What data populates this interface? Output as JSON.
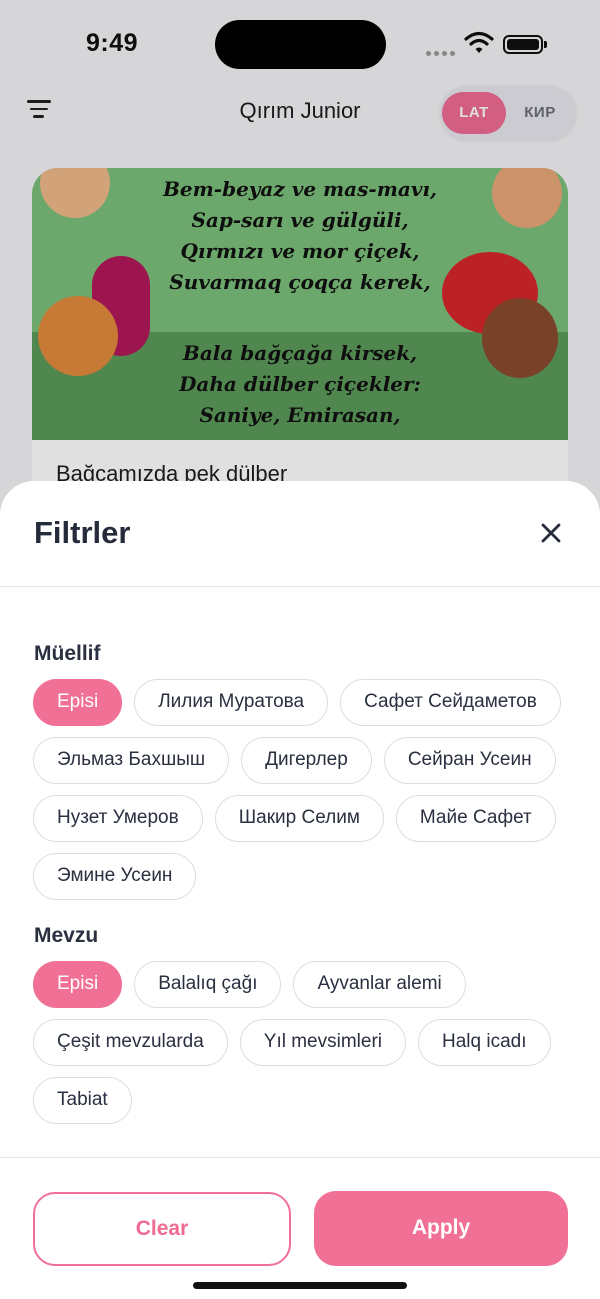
{
  "status": {
    "time": "9:49"
  },
  "app": {
    "title": "Qırım Junior",
    "lang": {
      "lat": "LAT",
      "kir": "КИР",
      "selected": "LAT"
    }
  },
  "card": {
    "poem_top": [
      "Bem-beyaz ve mas-mavı,",
      "Sap-sarı ve gülgüli,",
      "Qırmızı ve mor çiçek,",
      "Suvarmaq çoqça kerek,"
    ],
    "poem_bottom": [
      "Bala bağçağa kirsek,",
      "Daha dülber çiçekler:",
      "Saniye, Emirasan,"
    ],
    "title": "Bağçamızda pek dülber"
  },
  "filters": {
    "title": "Filtrler",
    "author": {
      "label": "Müellif",
      "options": [
        {
          "label": "Episi",
          "selected": true
        },
        {
          "label": "Лилия Муратова",
          "selected": false
        },
        {
          "label": "Сафет Сейдаметов",
          "selected": false
        },
        {
          "label": "Эльмаз Бахшыш",
          "selected": false
        },
        {
          "label": "Дигерлер",
          "selected": false
        },
        {
          "label": "Сейран Усеин",
          "selected": false
        },
        {
          "label": "Нузет Умеров",
          "selected": false
        },
        {
          "label": "Шакир Селим",
          "selected": false
        },
        {
          "label": "Майе Сафет",
          "selected": false
        },
        {
          "label": "Эмине Усеин",
          "selected": false
        }
      ]
    },
    "topic": {
      "label": "Mevzu",
      "options": [
        {
          "label": "Episi",
          "selected": true
        },
        {
          "label": "Balalıq çağı",
          "selected": false
        },
        {
          "label": "Ayvanlar alemi",
          "selected": false
        },
        {
          "label": "Çeşit mevzularda",
          "selected": false
        },
        {
          "label": "Yıl mevsimleri",
          "selected": false
        },
        {
          "label": "Halq icadı",
          "selected": false
        },
        {
          "label": "Tabiat",
          "selected": false
        }
      ]
    },
    "clear_label": "Clear",
    "apply_label": "Apply"
  },
  "colors": {
    "accent": "#f07096",
    "text": "#252b3b",
    "border": "#dcdde2"
  }
}
